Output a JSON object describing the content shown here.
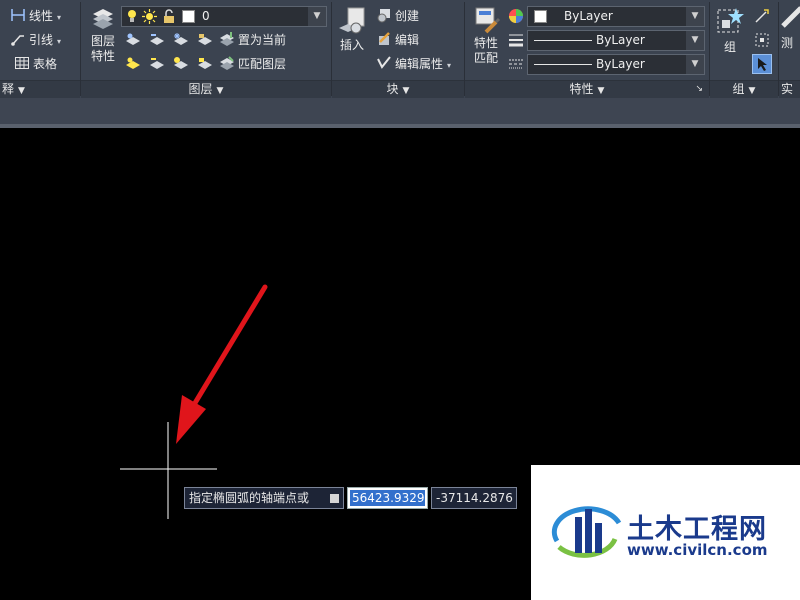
{
  "ribbon": {
    "annotation_panel": {
      "linetype_label": "线性",
      "leader_label": "引线",
      "table_label": "表格",
      "footer_label": "释"
    },
    "layers_panel": {
      "layer_properties_label_1": "图层",
      "layer_properties_label_2": "特性",
      "current_layer_value": "0",
      "set_current_label": "置为当前",
      "match_layer_label": "匹配图层",
      "footer_label": "图层"
    },
    "block_panel": {
      "insert_label": "插入",
      "create_label": "创建",
      "edit_label": "编辑",
      "edit_attributes_label": "编辑属性",
      "footer_label": "块"
    },
    "properties_panel": {
      "match_label_1": "特性",
      "match_label_2": "匹配",
      "color_value": "ByLayer",
      "lineweight_value": "ByLayer",
      "linetype_value": "ByLayer",
      "footer_label": "特性"
    },
    "groups_panel": {
      "group_label": "组",
      "footer_label": "组"
    },
    "utilities_panel": {
      "measure_label": "测",
      "footer_label": "实用"
    }
  },
  "dynamic_input": {
    "prompt": "指定椭圆弧的轴端点或",
    "x_value": "56423.9329",
    "y_value": "-37114.2876"
  },
  "watermark": {
    "title": "土木工程网",
    "url": "www.civilcn.com"
  },
  "colors": {
    "ribbon_bg": "#3b4350",
    "canvas_bg": "#000000",
    "arrow": "#e0151b",
    "crosshair": "#ffffff",
    "highlight": "#3370cc",
    "watermark_blue": "#1a3a8c"
  }
}
